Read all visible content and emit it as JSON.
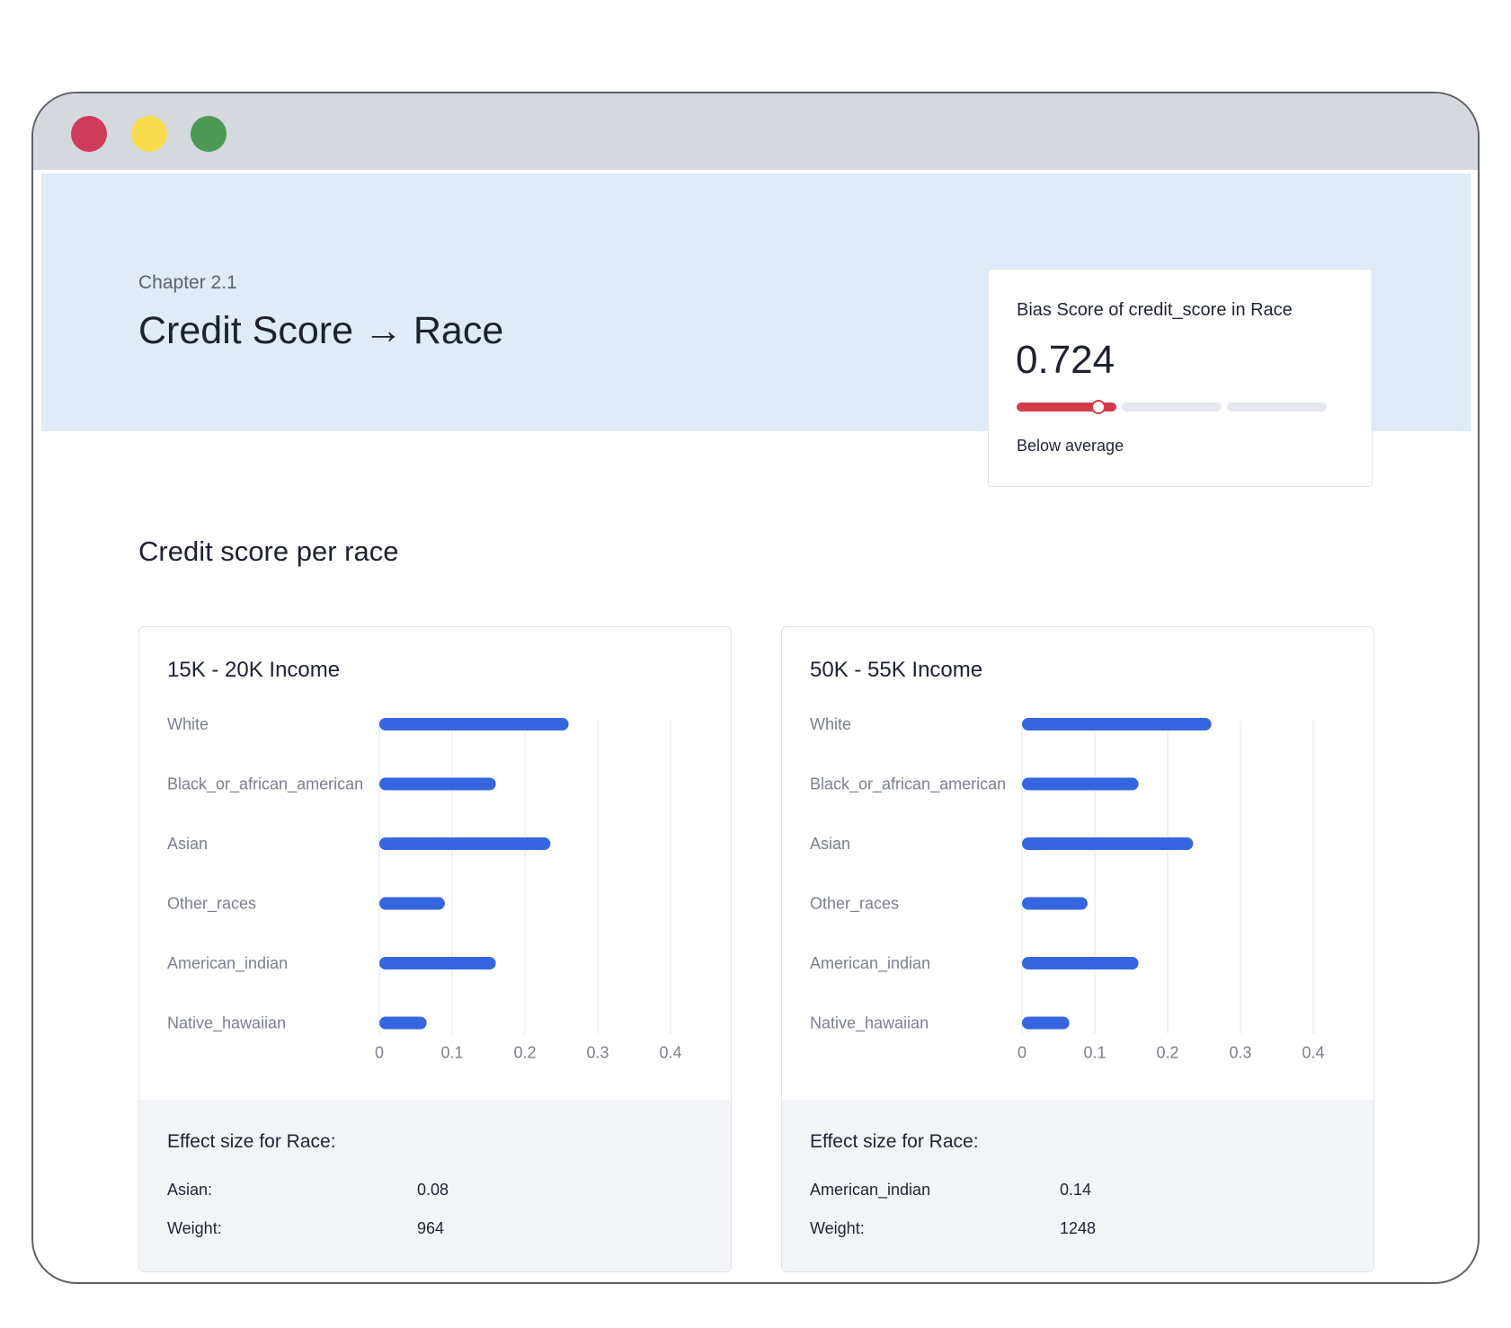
{
  "window": {
    "controls": [
      "close",
      "minimize",
      "maximize"
    ]
  },
  "header": {
    "chapter": "Chapter 2.1",
    "title": "Credit Score → Race"
  },
  "bias_card": {
    "label": "Bias Score of credit_score in Race",
    "value": "0.724",
    "level": 0.724,
    "status": "Below average",
    "colors": {
      "fill": "#d33a4b",
      "track": "#e4e7ed"
    }
  },
  "section": {
    "title": "Credit score per race"
  },
  "chart_data": [
    {
      "type": "bar",
      "orientation": "horizontal",
      "title": "15K - 20K Income",
      "categories": [
        "White",
        "Black_or_african_american",
        "Asian",
        "Other_races",
        "American_indian",
        "Native_hawaiian"
      ],
      "values": [
        0.26,
        0.16,
        0.235,
        0.09,
        0.16,
        0.065
      ],
      "xlim": [
        0,
        0.4
      ],
      "xticks": [
        "0",
        "0.1",
        "0.2",
        "0.3",
        "0.4"
      ],
      "grid": "vertical",
      "bar_color": "#3566e0"
    },
    {
      "type": "bar",
      "orientation": "horizontal",
      "title": "50K - 55K Income",
      "categories": [
        "White",
        "Black_or_african_american",
        "Asian",
        "Other_races",
        "American_indian",
        "Native_hawaiian"
      ],
      "values": [
        0.26,
        0.16,
        0.235,
        0.09,
        0.16,
        0.065
      ],
      "xlim": [
        0,
        0.4
      ],
      "xticks": [
        "0",
        "0.1",
        "0.2",
        "0.3",
        "0.4"
      ],
      "grid": "vertical",
      "bar_color": "#3566e0"
    }
  ],
  "effects": [
    {
      "title": "Effect size for Race:",
      "rows": [
        {
          "key": "Asian:",
          "value": "0.08"
        },
        {
          "key": "Weight:",
          "value": "964"
        }
      ]
    },
    {
      "title": "Effect size for Race:",
      "rows": [
        {
          "key": "American_indian",
          "value": "0.14"
        },
        {
          "key": "Weight:",
          "value": "1248"
        }
      ]
    }
  ]
}
